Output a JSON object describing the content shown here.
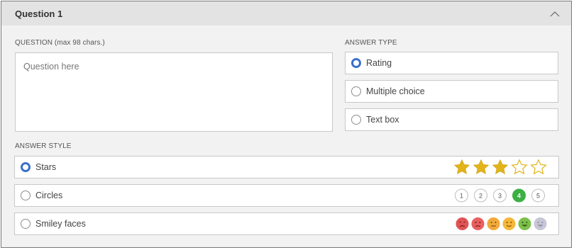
{
  "header": {
    "title": "Question 1",
    "collapse_icon": "chevron-up-icon"
  },
  "question": {
    "label": "QUESTION (max 98 chars.)",
    "placeholder": "Question here",
    "value": ""
  },
  "answer_type": {
    "label": "ANSWER TYPE",
    "options": [
      {
        "label": "Rating",
        "selected": true
      },
      {
        "label": "Multiple choice",
        "selected": false
      },
      {
        "label": "Text box",
        "selected": false
      }
    ]
  },
  "answer_style": {
    "label": "ANSWER STYLE",
    "options": [
      {
        "label": "Stars",
        "selected": true,
        "preview": {
          "filled_stars": 3,
          "total_stars": 5
        }
      },
      {
        "label": "Circles",
        "selected": false,
        "preview": {
          "numbers": [
            "1",
            "2",
            "3",
            "4",
            "5"
          ],
          "active": "4"
        }
      },
      {
        "label": "Smiley faces",
        "selected": false,
        "preview": {
          "faces": [
            "very-sad",
            "sad",
            "neutral",
            "content",
            "happy",
            "disabled"
          ]
        }
      }
    ]
  },
  "colors": {
    "radio_selected": "#3b6fcf",
    "star": "#e2b41a",
    "circle_active": "#3cb043",
    "smiley_red": "#e05555",
    "smiley_orange": "#f2a93b",
    "smiley_green": "#7cc04b",
    "smiley_grey": "#c6c6d6"
  }
}
